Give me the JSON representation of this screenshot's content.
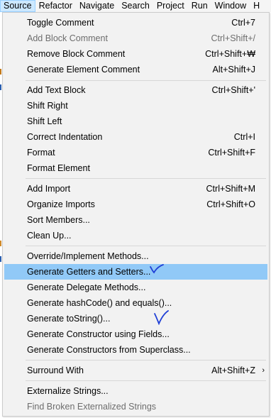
{
  "menubar": {
    "items": [
      "Source",
      "Refactor",
      "Navigate",
      "Search",
      "Project",
      "Run",
      "Window",
      "H"
    ]
  },
  "menu": {
    "items": [
      {
        "label": "Toggle Comment",
        "shortcut": "Ctrl+7"
      },
      {
        "label": "Add Block Comment",
        "shortcut": "Ctrl+Shift+/",
        "disabled": true
      },
      {
        "label": "Remove Block Comment",
        "shortcut": "Ctrl+Shift+₩"
      },
      {
        "label": "Generate Element Comment",
        "shortcut": "Alt+Shift+J"
      },
      {
        "label": "Add Text Block",
        "shortcut": "Ctrl+Shift+'"
      },
      {
        "label": "Shift Right",
        "shortcut": ""
      },
      {
        "label": "Shift Left",
        "shortcut": ""
      },
      {
        "label": "Correct Indentation",
        "shortcut": "Ctrl+I"
      },
      {
        "label": "Format",
        "shortcut": "Ctrl+Shift+F"
      },
      {
        "label": "Format Element",
        "shortcut": ""
      },
      {
        "label": "Add Import",
        "shortcut": "Ctrl+Shift+M"
      },
      {
        "label": "Organize Imports",
        "shortcut": "Ctrl+Shift+O"
      },
      {
        "label": "Sort Members...",
        "shortcut": ""
      },
      {
        "label": "Clean Up...",
        "shortcut": ""
      },
      {
        "label": "Override/Implement Methods...",
        "shortcut": ""
      },
      {
        "label": "Generate Getters and Setters...",
        "shortcut": "",
        "selected": true
      },
      {
        "label": "Generate Delegate Methods...",
        "shortcut": ""
      },
      {
        "label": "Generate hashCode() and equals()...",
        "shortcut": ""
      },
      {
        "label": "Generate toString()...",
        "shortcut": ""
      },
      {
        "label": "Generate Constructor using Fields...",
        "shortcut": ""
      },
      {
        "label": "Generate Constructors from Superclass...",
        "shortcut": ""
      },
      {
        "label": "Surround With",
        "shortcut": "Alt+Shift+Z",
        "submenu": true
      },
      {
        "label": "Externalize Strings...",
        "shortcut": ""
      },
      {
        "label": "Find Broken Externalized Strings",
        "shortcut": "",
        "disabled": true
      }
    ]
  },
  "colors": {
    "selection": "#91c9f7",
    "annotation": "#1f3fd6"
  }
}
